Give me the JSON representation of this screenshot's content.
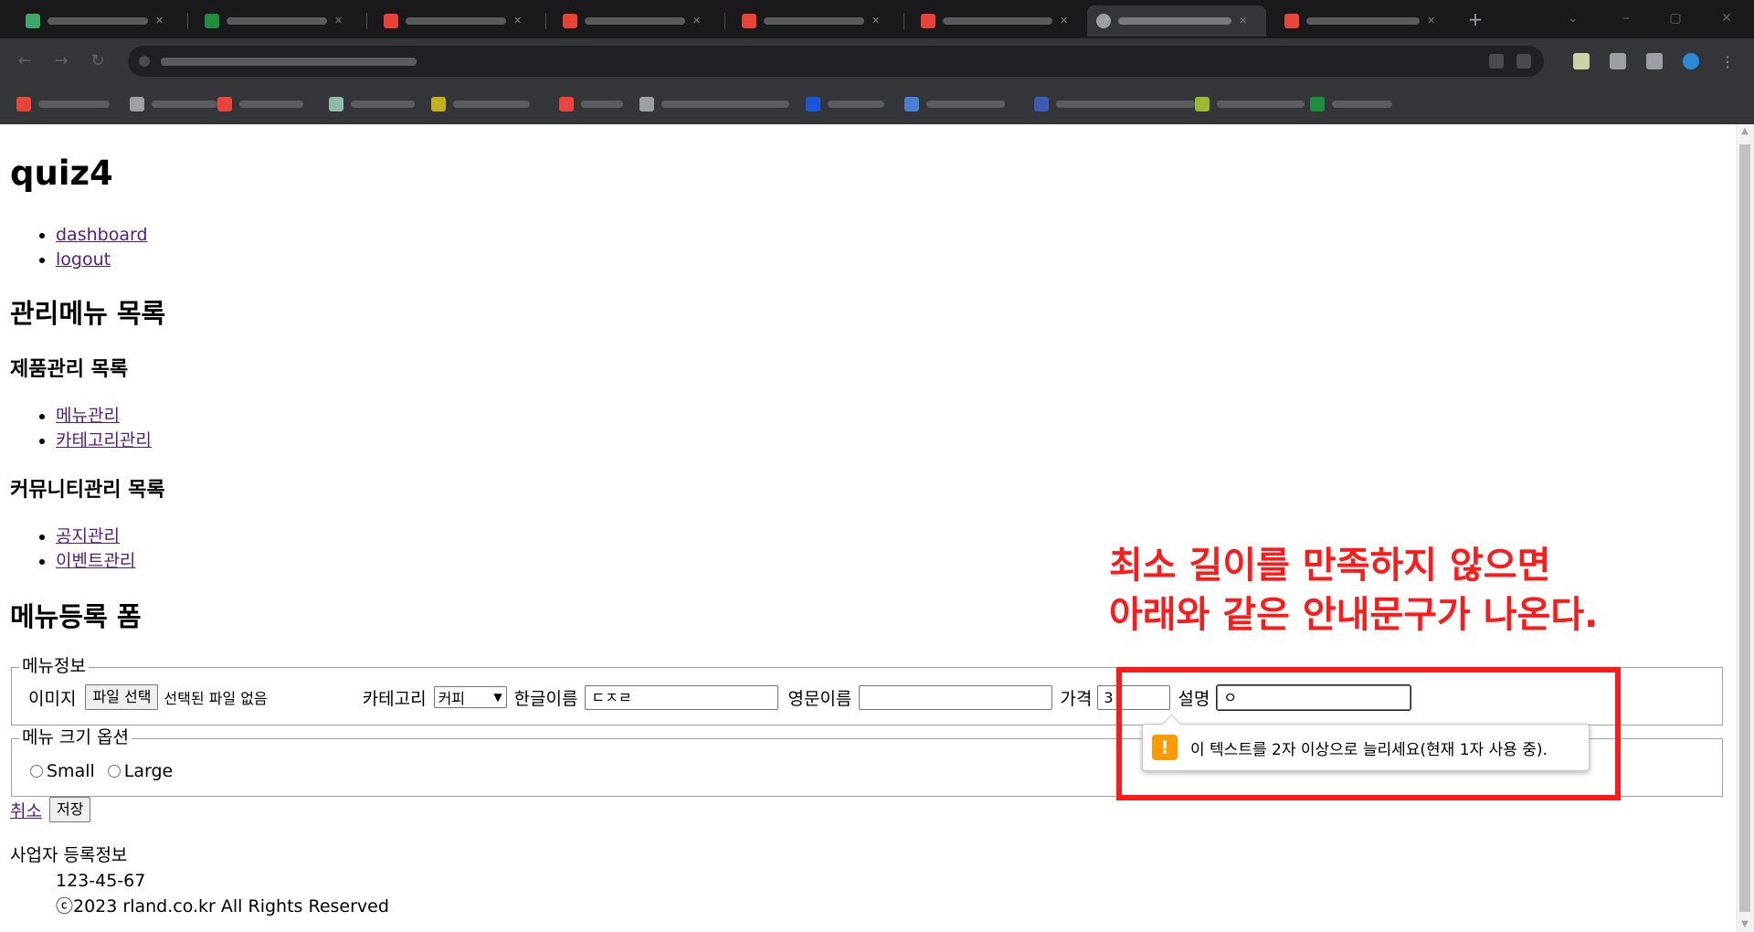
{
  "browser": {
    "tabs": [
      {
        "fav": "#3fa66a"
      },
      {
        "fav": "#1e8e3e"
      },
      {
        "fav": "#ea4335"
      },
      {
        "fav": "#ea4335"
      },
      {
        "fav": "#ea4335"
      },
      {
        "fav": "#ea4335"
      },
      {
        "fav": "#9aa0a6",
        "active": true
      },
      {
        "fav": "#e8453c"
      }
    ]
  },
  "page": {
    "title": "quiz4",
    "top_links": [
      "dashboard",
      "logout"
    ],
    "admin_menu_heading": "관리메뉴 목록",
    "product_heading": "제품관리 목록",
    "product_links": [
      "메뉴관리",
      "카테고리관리"
    ],
    "community_heading": "커뮤니티관리 목록",
    "community_links": [
      "공지관리",
      "이벤트관리"
    ],
    "form_heading": "메뉴등록 폼",
    "menu_info": {
      "legend": "메뉴정보",
      "image_label": "이미지",
      "file_button": "파일 선택",
      "file_status": "선택된 파일 없음",
      "category_label": "카테고리",
      "category_value": "커피",
      "korean_name_label": "한글이름",
      "korean_name_value": "ㄷㅈㄹ",
      "english_name_label": "영문이름",
      "english_name_value": "",
      "price_label": "가격",
      "price_value": "3",
      "description_label": "설명",
      "description_value": "ㅇ"
    },
    "size_options": {
      "legend": "메뉴 크기 옵션",
      "small": "Small",
      "large": "Large"
    },
    "cancel_link": "취소",
    "save_button": "저장",
    "footer": {
      "heading": "사업자 등록정보",
      "reg_number": "123-45-67",
      "copyright": "ⓒ2023 rland.co.kr All Rights Reserved"
    },
    "validation_tooltip": "이 텍스트를 2자 이상으로 늘리세요(현재 1자 사용 중).",
    "annotation": {
      "line1": "최소 길이를 만족하지 않으면",
      "line2": "아래와 같은 안내문구가 나온다.",
      "color": "#ff1a1a"
    }
  }
}
